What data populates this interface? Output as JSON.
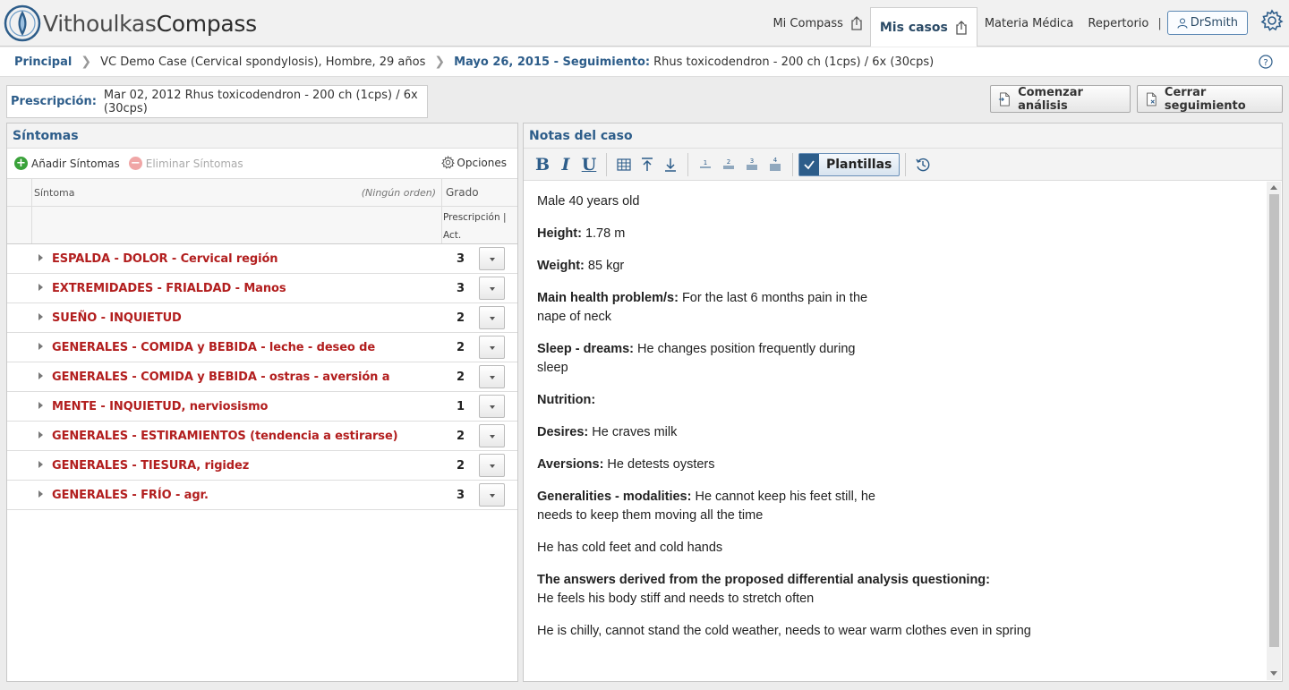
{
  "brand": {
    "part1": "Vithoulkas",
    "part2": "Compass"
  },
  "nav": {
    "mi_compass": "Mi Compass",
    "mis_casos": "Mis casos",
    "materia_medica": "Materia Médica",
    "repertorio": "Repertorio",
    "separator": "|",
    "user": "DrSmith"
  },
  "breadcrumb": {
    "home": "Principal",
    "case": "VC Demo Case (Cervical spondylosis), Hombre, 29 años",
    "date_label": "Mayo 26, 2015 - Seguimiento:",
    "followup": "Rhus toxicodendron - 200 ch (1cps) / 6x (30cps)"
  },
  "prescription": {
    "label": "Prescripción:",
    "value": "Mar 02, 2012 Rhus toxicodendron - 200 ch (1cps) / 6x (30cps)"
  },
  "actions": {
    "start_analysis": "Comenzar análisis",
    "close_followup": "Cerrar seguimiento"
  },
  "symptoms": {
    "title": "Síntomas",
    "add": "Añadir Síntomas",
    "remove": "Eliminar Síntomas",
    "options": "Opciones",
    "col_symptom": "Síntoma",
    "col_order": "(Ningún orden)",
    "col_grade": "Grado",
    "col_sub1": "Prescripción |",
    "col_sub2": "Act.",
    "rows": [
      {
        "label": "ESPALDA - DOLOR - Cervical región",
        "grade": "3"
      },
      {
        "label": "EXTREMIDADES - FRIALDAD - Manos",
        "grade": "3"
      },
      {
        "label": "SUEÑO - INQUIETUD",
        "grade": "2"
      },
      {
        "label": "GENERALES - COMIDA y BEBIDA - leche - deseo de",
        "grade": "2"
      },
      {
        "label": "GENERALES - COMIDA y BEBIDA - ostras - aversión a",
        "grade": "2"
      },
      {
        "label": "MENTE - INQUIETUD, nerviosismo",
        "grade": "1"
      },
      {
        "label": "GENERALES - ESTIRAMIENTOS (tendencia a estirarse)",
        "grade": "2"
      },
      {
        "label": "GENERALES - TIESURA, rigidez",
        "grade": "2"
      },
      {
        "label": "GENERALES - FRÍO - agr.",
        "grade": "3"
      }
    ]
  },
  "notes": {
    "title": "Notas del caso",
    "templates": "Plantillas",
    "line_intro": "Male 40 years old",
    "height_k": "Height:",
    "height_v": " 1.78 m",
    "weight_k": "Weight:",
    "weight_v": " 85 kgr",
    "main_k": "Main health problem/s:",
    "main_v1": " For the last 6 months pain in the",
    "main_v2": "nape of neck",
    "sleep_k": "Sleep - dreams:",
    "sleep_v1": " He changes position frequently during",
    "sleep_v2": "sleep",
    "nutrition_k": "Nutrition:",
    "desires_k": "Desires:",
    "desires_v": " He craves milk",
    "aversions_k": "Aversions:",
    "aversions_v": " He detests oysters",
    "gen_k": "Generalities - modalities:",
    "gen_v1": " He cannot keep his feet still, he",
    "gen_v2": "needs to keep them moving all the time",
    "cold_line": "He has cold feet and cold hands",
    "answers_k": "The answers derived from the proposed differential analysis questioning:",
    "answers_v": "He feels his body stiff and needs to stretch often",
    "chilly_line": "He is chilly, cannot stand the cold weather, needs to wear warm clothes even in spring"
  },
  "colors": {
    "accent": "#2d5d8a",
    "symptom": "#b21e1e"
  }
}
